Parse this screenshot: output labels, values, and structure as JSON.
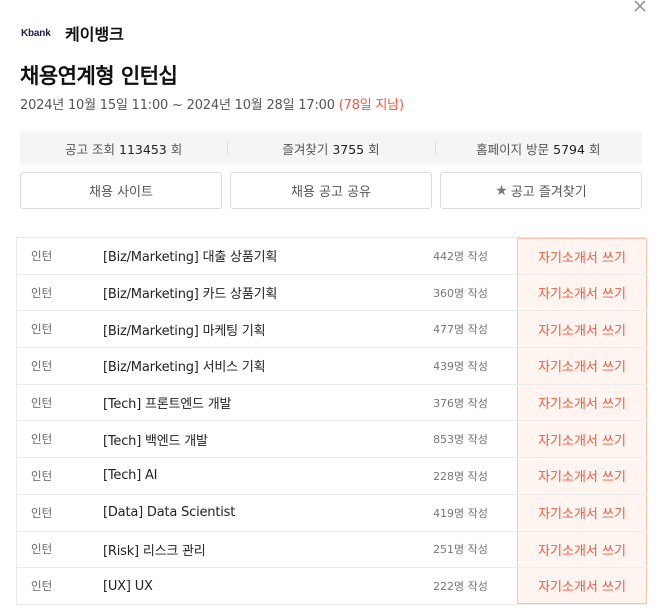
{
  "header": {
    "company_logo": "Kbank",
    "company_name": "케이뱅크",
    "title": "채용연계형 인턴십",
    "period": "2024년 10월 15일 11:00 ~ 2024년 10월 28일 17:00",
    "dday": "(78일 지남)"
  },
  "stats": {
    "views_label": "공고 조회",
    "views_value": "113453",
    "views_unit": "회",
    "favorites_label": "즐겨찾기",
    "favorites_value": "3755",
    "favorites_unit": "회",
    "homepage_label": "홈페이지 방문",
    "homepage_value": "5794",
    "homepage_unit": "회"
  },
  "actions": {
    "site": "채용 사이트",
    "share": "채용 공고 공유",
    "favorite": "공고 즐겨찾기"
  },
  "positions": [
    {
      "type": "인턴",
      "name": "[Biz/Marketing] 대출 상품기획",
      "count": "442명 작성",
      "action": "자기소개서 쓰기"
    },
    {
      "type": "인턴",
      "name": "[Biz/Marketing] 카드 상품기획",
      "count": "360명 작성",
      "action": "자기소개서 쓰기"
    },
    {
      "type": "인턴",
      "name": "[Biz/Marketing] 마케팅 기획",
      "count": "477명 작성",
      "action": "자기소개서 쓰기"
    },
    {
      "type": "인턴",
      "name": "[Biz/Marketing] 서비스 기획",
      "count": "439명 작성",
      "action": "자기소개서 쓰기"
    },
    {
      "type": "인턴",
      "name": "[Tech] 프론트엔드 개발",
      "count": "376명 작성",
      "action": "자기소개서 쓰기"
    },
    {
      "type": "인턴",
      "name": "[Tech] 백엔드 개발",
      "count": "853명 작성",
      "action": "자기소개서 쓰기"
    },
    {
      "type": "인턴",
      "name": "[Tech] AI",
      "count": "228명 작성",
      "action": "자기소개서 쓰기"
    },
    {
      "type": "인턴",
      "name": "[Data] Data Scientist",
      "count": "419명 작성",
      "action": "자기소개서 쓰기"
    },
    {
      "type": "인턴",
      "name": "[Risk] 리스크 관리",
      "count": "251명 작성",
      "action": "자기소개서 쓰기"
    },
    {
      "type": "인턴",
      "name": "[UX] UX",
      "count": "222명 작성",
      "action": "자기소개서 쓰기"
    }
  ],
  "colors": {
    "accent": "#f0593f",
    "accent_bg": "#fff5f0",
    "stats_bg": "#f5f5f5"
  }
}
